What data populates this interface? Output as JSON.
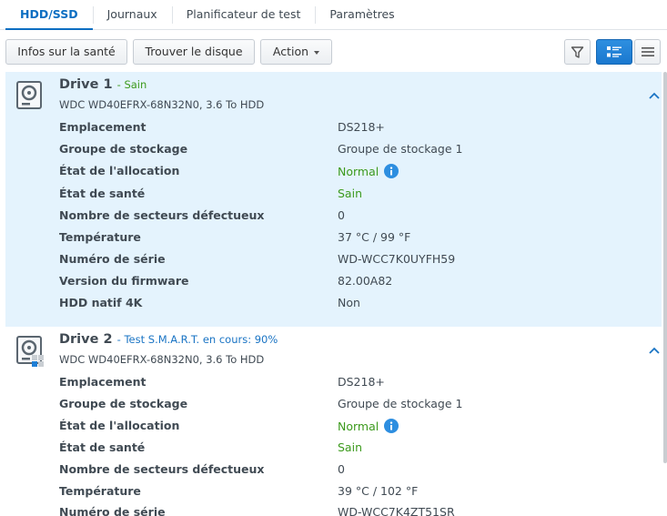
{
  "tabs": [
    {
      "label": "HDD/SSD",
      "active": true
    },
    {
      "label": "Journaux",
      "active": false
    },
    {
      "label": "Planificateur de test",
      "active": false
    },
    {
      "label": "Paramètres",
      "active": false
    }
  ],
  "toolbar": {
    "health_info": "Infos sur la santé",
    "find_disk": "Trouver le disque",
    "action": "Action"
  },
  "colors": {
    "accent": "#0b6ec2",
    "healthy": "#3c9a1d",
    "selected_bg": "#e4f3fd"
  },
  "drives": [
    {
      "name": "Drive 1",
      "status": "- Sain",
      "model": "WDC WD40EFRX-68N32N0, 3.6 To HDD",
      "rows": [
        {
          "label": "Emplacement",
          "value": "DS218+"
        },
        {
          "label": "Groupe de stockage",
          "value": "Groupe de stockage 1"
        },
        {
          "label": "État de l'allocation",
          "value": "Normal"
        },
        {
          "label": "État de santé",
          "value": "Sain"
        },
        {
          "label": "Nombre de secteurs défectueux",
          "value": "0"
        },
        {
          "label": "Température",
          "value": "37 °C / 99 °F"
        },
        {
          "label": "Numéro de série",
          "value": "WD-WCC7K0UYFH59"
        },
        {
          "label": "Version du firmware",
          "value": "82.00A82"
        },
        {
          "label": "HDD natif 4K",
          "value": "Non"
        }
      ]
    },
    {
      "name": "Drive 2",
      "status": "- Test S.M.A.R.T. en cours: 90%",
      "model": "WDC WD40EFRX-68N32N0, 3.6 To HDD",
      "rows": [
        {
          "label": "Emplacement",
          "value": "DS218+"
        },
        {
          "label": "Groupe de stockage",
          "value": "Groupe de stockage 1"
        },
        {
          "label": "État de l'allocation",
          "value": "Normal"
        },
        {
          "label": "État de santé",
          "value": "Sain"
        },
        {
          "label": "Nombre de secteurs défectueux",
          "value": "0"
        },
        {
          "label": "Température",
          "value": "39 °C / 102 °F"
        },
        {
          "label": "Numéro de série",
          "value": "WD-WCC7K4ZT51SR"
        }
      ]
    }
  ]
}
